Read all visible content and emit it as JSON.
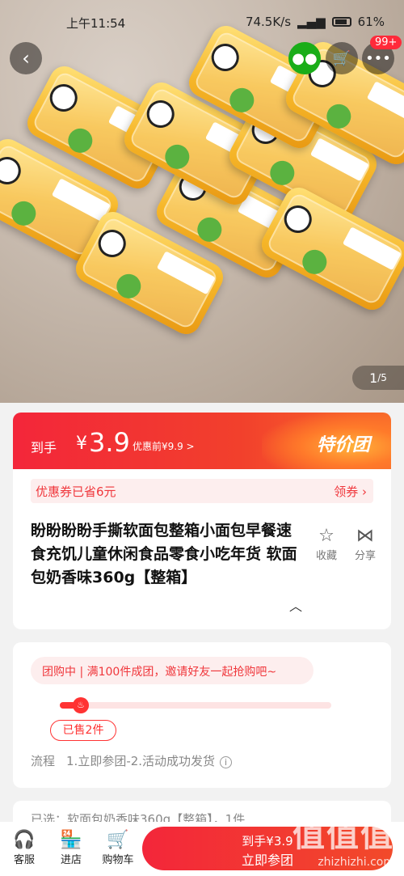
{
  "status_bar": {
    "time": "上午11:54",
    "speed": "74.5K/s",
    "battery": "61%"
  },
  "header": {
    "cart_badge": "99+",
    "back_icon": "chevron-left-icon",
    "wechat_icon": "wechat-icon",
    "cart_icon": "cart-icon",
    "more_icon": "more-icon"
  },
  "gallery": {
    "current": "1",
    "total": "/5"
  },
  "price_banner": {
    "label": "到手",
    "currency": "¥",
    "price": "3.9",
    "before": "优惠前¥9.9 >",
    "tag": "特价团"
  },
  "coupon": {
    "left": "优惠券已省6元",
    "right": "领券 ›"
  },
  "product": {
    "title": "盼盼盼盼手撕软面包整箱小面包早餐速食充饥儿童休闲食品零食小吃年货 软面包奶香味360g【整箱】",
    "collect": "收藏",
    "share": "分享"
  },
  "group": {
    "status": "团购中 | 满100件成团，邀请好友一起抢购吧~",
    "progress": 0.06,
    "sold": "已售2件",
    "flow_label": "流程",
    "flow_steps": "1.立即参团-2.活动成功发货"
  },
  "selection": {
    "text": "已选：软面包奶香味360g【整箱】，1件"
  },
  "bottom_bar": {
    "service": "客服",
    "store": "进店",
    "cart": "购物车",
    "buy_price": "到手¥3.9",
    "buy_label": "立即参团"
  },
  "watermark": {
    "logo": "值值值",
    "url": "zhizhizhi.com"
  },
  "colors": {
    "accent": "#f3263a",
    "coupon_bg": "#fdeeee"
  }
}
